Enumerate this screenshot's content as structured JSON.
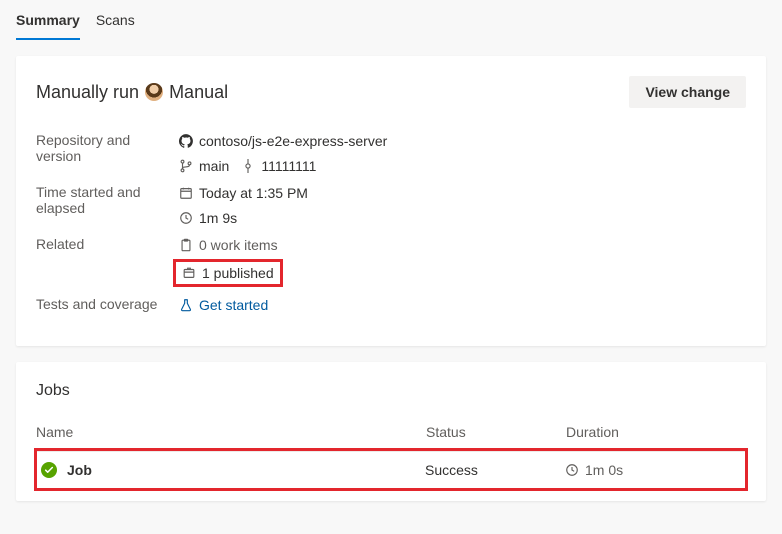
{
  "tabs": {
    "summary": "Summary",
    "scans": "Scans"
  },
  "run": {
    "prefix": "Manually run",
    "suffix": "Manual"
  },
  "buttons": {
    "view_change": "View change"
  },
  "labels": {
    "repo_version": "Repository and version",
    "time": "Time started and elapsed",
    "related": "Related",
    "tests": "Tests and coverage"
  },
  "repo": {
    "full": "contoso/js-e2e-express-server",
    "branch": "main",
    "commit": "11111111"
  },
  "time": {
    "started": "Today at 1:35 PM",
    "elapsed": "1m 9s"
  },
  "related": {
    "work_items": "0 work items",
    "published": "1 published"
  },
  "tests": {
    "get_started": "Get started"
  },
  "jobs": {
    "title": "Jobs",
    "col_name": "Name",
    "col_status": "Status",
    "col_duration": "Duration",
    "rows": [
      {
        "name": "Job",
        "status": "Success",
        "duration": "1m 0s"
      }
    ]
  }
}
